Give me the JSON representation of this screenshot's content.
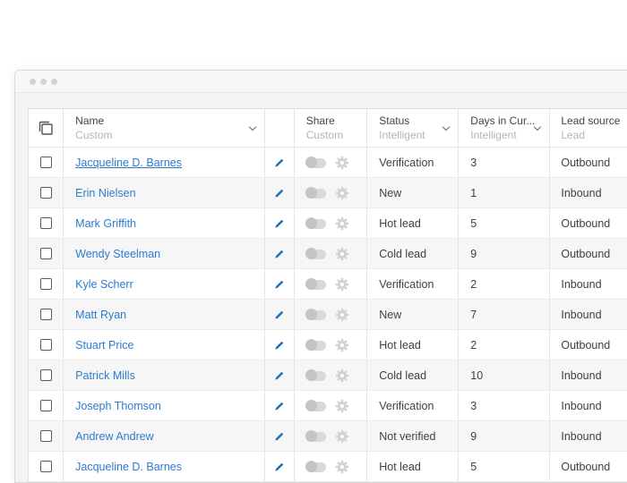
{
  "columns": {
    "name": {
      "title": "Name",
      "sub": "Custom"
    },
    "share": {
      "title": "Share",
      "sub": "Custom"
    },
    "status": {
      "title": "Status",
      "sub": "Intelligent"
    },
    "days": {
      "title": "Days in Cur...",
      "sub": "Intelligent"
    },
    "lead": {
      "title": "Lead source",
      "sub": "Lead"
    }
  },
  "rows": [
    {
      "name": "Jacqueline D. Barnes",
      "status": "Verification",
      "days": "3",
      "lead": "Outbound"
    },
    {
      "name": "Erin Nielsen",
      "status": "New",
      "days": "1",
      "lead": "Inbound"
    },
    {
      "name": "Mark Griffith",
      "status": "Hot lead",
      "days": "5",
      "lead": "Outbound"
    },
    {
      "name": "Wendy Steelman",
      "status": "Cold lead",
      "days": "9",
      "lead": "Outbound"
    },
    {
      "name": "Kyle Scherr",
      "status": "Verification",
      "days": "2",
      "lead": "Inbound"
    },
    {
      "name": "Matt Ryan",
      "status": "New",
      "days": "7",
      "lead": "Inbound"
    },
    {
      "name": "Stuart Price",
      "status": "Hot lead",
      "days": "2",
      "lead": "Outbound"
    },
    {
      "name": "Patrick Mills",
      "status": "Cold lead",
      "days": "10",
      "lead": "Inbound"
    },
    {
      "name": "Joseph Thomson",
      "status": "Verification",
      "days": "3",
      "lead": "Inbound"
    },
    {
      "name": "Andrew Andrew",
      "status": "Not verified",
      "days": "9",
      "lead": "Inbound"
    },
    {
      "name": "Jacqueline D. Barnes",
      "status": "Hot lead",
      "days": "5",
      "lead": "Outbound"
    }
  ],
  "icons": {
    "select_all": "copy-icon",
    "edit": "pencil-icon",
    "share_toggle": "toggle-icon",
    "share_settings": "gear-icon",
    "sort": "chevron-down-icon"
  },
  "colors": {
    "link": "#2b7bd1",
    "pencil": "#1f6fc4",
    "toggle": "#c4c4c4"
  }
}
